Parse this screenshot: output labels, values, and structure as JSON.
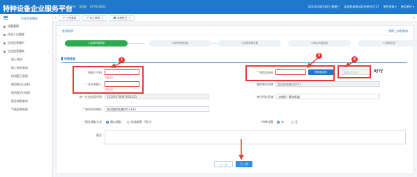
{
  "header": {
    "title": "特种设备企业服务平台",
    "subtitle": "技术支持：  QQ群：  857634852",
    "datetime": "2022年08月30日 星期三",
    "welcome": "欢迎登录测试综合单位0717",
    "role_switch": "角色切换 ▾",
    "user_unit": "使用单位 ▾"
  },
  "sidebar": {
    "home": "企业信息服务",
    "items": [
      {
        "label": "设备管理",
        "chev": "›"
      },
      {
        "label": "作业人员管理",
        "chev": "›"
      },
      {
        "label": "企业信息维护",
        "chev": "›"
      },
      {
        "label": "企业信息服务",
        "chev": "⌄"
      }
    ],
    "subitems": [
      "网上审核",
      "网上审核查询",
      "检测更正表报",
      "使用登记(分表)",
      "使用登记(办理)",
      "报告领取查询",
      "气瓶追溯系统"
    ]
  },
  "tabs": {
    "items": [
      {
        "label": "工作桌面"
      },
      {
        "label": "网上审核"
      },
      {
        "label": "申报登记"
      }
    ]
  },
  "panel": {
    "title": "使用说明",
    "right_link": "到网上申报查询"
  },
  "steps": [
    "1.选择申报类型",
    "2.填写申报信息",
    "3.选择申报设备",
    "4.确认申报信息",
    "5.申报完成"
  ],
  "section": {
    "title": "申报信息"
  },
  "form": {
    "applicant_name_label": "申报人手机",
    "applicant_name_error": "不能为空",
    "contact_label": "本次申报人",
    "contact_error": "不能为空",
    "credit_code_label": "统一社会信用代码",
    "credit_code_value": "12345678987654321",
    "unit_address_label": "单位所在地址",
    "unit_address_value": "测试路综合路0411333",
    "report_method_label": "报告领取方式",
    "report_method_options": [
      "窗口领取",
      "快递邮寄（到付）"
    ],
    "remarks_label": "备注",
    "sms_code_label": "短信验证码",
    "get_code_button": "获取验证码",
    "image_code_placeholder": "图形验证码",
    "captcha_text": "0ƒ7ƒ",
    "unit_name_label": "使用单位名称",
    "unit_name_value": "测试综合单位0717",
    "unit_region_label": "单位所在区域",
    "unit_region_value": "江南街 / 青年街道",
    "guard_label": "特种设备",
    "guard_options": [
      "有",
      "无"
    ]
  },
  "buttons": {
    "prev": "上一步",
    "next": "下一步"
  },
  "annotations": [
    "1",
    "2",
    "3"
  ]
}
